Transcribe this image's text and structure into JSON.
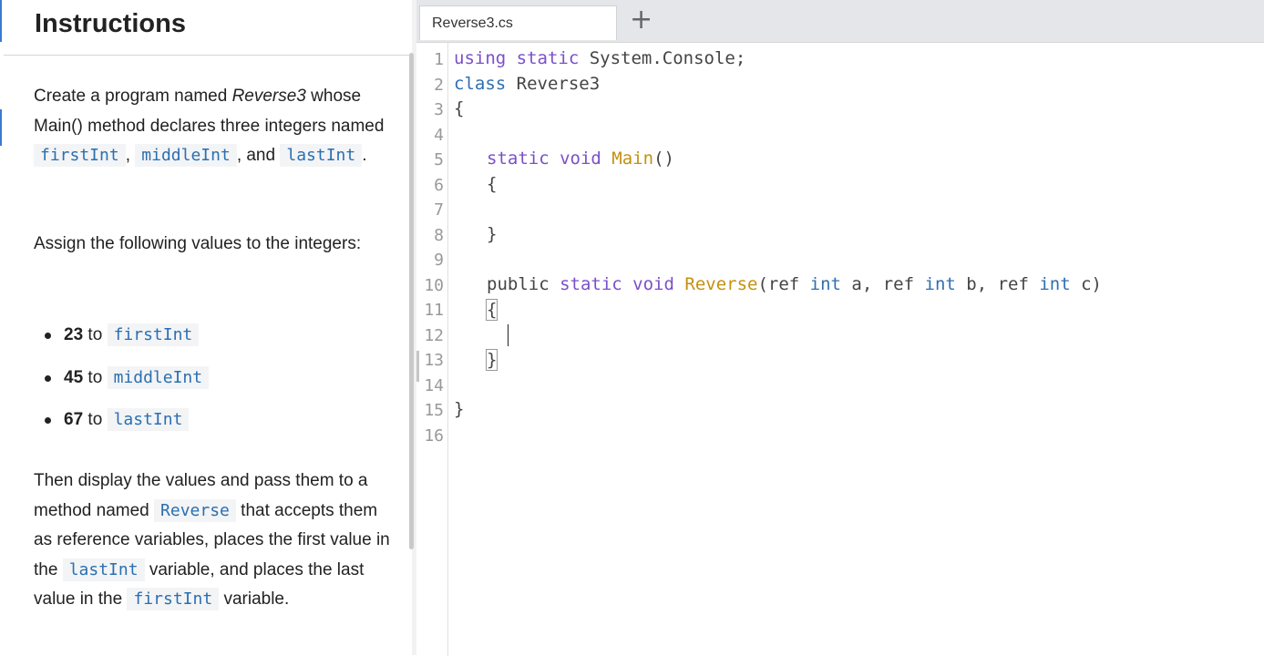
{
  "instructions": {
    "title": "Instructions",
    "p1": {
      "t1": "Create a program named ",
      "em": "Reverse3",
      "t2": " whose Main() method declares three integers named ",
      "c1": "firstInt",
      "t3": ", ",
      "c2": "middleInt",
      "t4": ", and ",
      "c3": "lastInt",
      "t5": "."
    },
    "p2": "Assign the following values to the integers:",
    "bullets": [
      {
        "value": "23",
        "to": "to",
        "var": "firstInt"
      },
      {
        "value": "45",
        "to": "to",
        "var": "middleInt"
      },
      {
        "value": "67",
        "to": "to",
        "var": "lastInt"
      }
    ],
    "p3": {
      "t1": "Then display the values and pass them to a method named ",
      "c1": "Reverse",
      "t2": " that accepts them as reference variables, places the first value in the ",
      "c2": "lastInt",
      "t3": " variable, and places the last value in the ",
      "c3": "firstInt",
      "t4": " variable."
    }
  },
  "editor": {
    "tab_label": "Reverse3.cs",
    "add_tab": "+",
    "line_numbers": [
      "1",
      "2",
      "3",
      "4",
      "5",
      "6",
      "7",
      "8",
      "9",
      "10",
      "11",
      "12",
      "13",
      "14",
      "15",
      "16"
    ],
    "code": {
      "l1a": "using static",
      "l1b": " System.Console;",
      "l2a": "class",
      "l2b": " Reverse3",
      "l3": "{",
      "l5a": "static void",
      "l5b": " ",
      "l5c": "Main",
      "l5d": "()",
      "l6": "{",
      "l8": "}",
      "l10a": "public ",
      "l10b": "static void",
      "l10c": " ",
      "l10d": "Reverse",
      "l10e": "(ref ",
      "l10f": "int",
      "l10g": " a, ref ",
      "l10h": "int",
      "l10i": " b, ref ",
      "l10j": "int",
      "l10k": " c)",
      "l11": "{",
      "l13": "}",
      "l15": "}"
    }
  }
}
